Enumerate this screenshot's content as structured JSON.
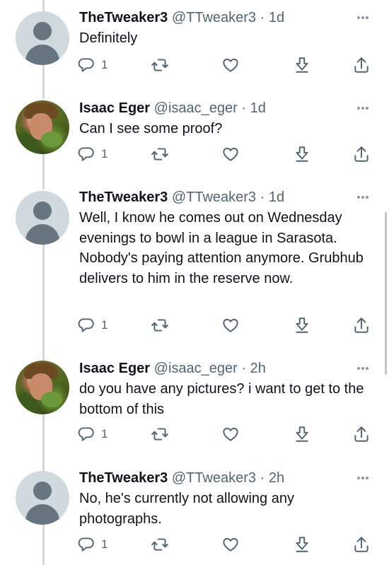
{
  "tweets": [
    {
      "name": "TheTweaker3",
      "handle": "@TTweaker3",
      "separator": "·",
      "time": "1d",
      "text": "Definitely",
      "reply_count": "1",
      "avatar": "default-avatar"
    },
    {
      "name": "Isaac Eger",
      "handle": "@isaac_eger",
      "separator": "·",
      "time": "1d",
      "text": "Can I see some proof?",
      "reply_count": "1",
      "avatar": "photo-avatar"
    },
    {
      "name": "TheTweaker3",
      "handle": "@TTweaker3",
      "separator": "·",
      "time": "1d",
      "text": "Well, I know he comes out on Wednesday evenings to bowl in a league in Sarasota. Nobody's paying attention anymore. Grubhub delivers to him in the reserve now.",
      "reply_count": "1",
      "avatar": "default-avatar"
    },
    {
      "name": "Isaac Eger",
      "handle": "@isaac_eger",
      "separator": "·",
      "time": "2h",
      "text": "do you have any pictures? i want to get to the bottom of this",
      "reply_count": "1",
      "avatar": "photo-avatar"
    },
    {
      "name": "TheTweaker3",
      "handle": "@TTweaker3",
      "separator": "·",
      "time": "2h",
      "text": "No, he's currently not allowing any photographs.",
      "reply_count": "1",
      "avatar": "default-avatar"
    }
  ],
  "icons": {
    "reply": "reply-icon",
    "retweet": "retweet-icon",
    "like": "heart-icon",
    "download": "download-icon",
    "share": "share-icon",
    "more": "more-icon"
  },
  "colors": {
    "text": "#0f1419",
    "secondary": "#536471",
    "thread_line": "#cfd9de"
  }
}
